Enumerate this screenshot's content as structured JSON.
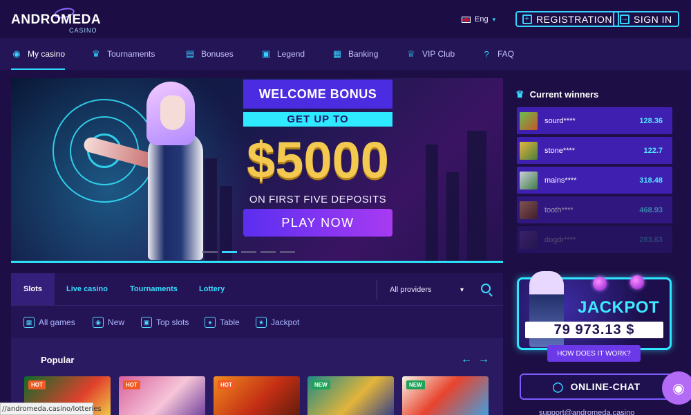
{
  "header": {
    "logo_main": "ANDROMEDA",
    "logo_sub": "CASINO",
    "language": "Eng",
    "registration": "REGISTRATION",
    "signin": "SIGN IN"
  },
  "nav": {
    "items": [
      {
        "label": "My casino",
        "icon": "astronaut-icon"
      },
      {
        "label": "Tournaments",
        "icon": "trophy-icon"
      },
      {
        "label": "Bonuses",
        "icon": "gift-icon"
      },
      {
        "label": "Legend",
        "icon": "book-icon"
      },
      {
        "label": "Banking",
        "icon": "wallet-icon"
      },
      {
        "label": "VIP Club",
        "icon": "crown-icon"
      },
      {
        "label": "FAQ",
        "icon": "faq-icon"
      }
    ]
  },
  "banner": {
    "title": "WELCOME BONUS",
    "subtitle": "GET UP TO",
    "amount": "$5000",
    "deposits": "ON FIRST FIVE DEPOSITS",
    "cta": "PLAY NOW",
    "active_slide": 2,
    "slide_count": 5
  },
  "winners": {
    "title": "Current winners",
    "rows": [
      {
        "name": "sourd****",
        "amount": "128.36"
      },
      {
        "name": "stone****",
        "amount": "122.7"
      },
      {
        "name": "mains****",
        "amount": "318.48"
      },
      {
        "name": "tooth****",
        "amount": "468.93"
      },
      {
        "name": "dogdr****",
        "amount": "283.63"
      }
    ]
  },
  "jackpot": {
    "title": "JACKPOT",
    "value": "79 973.13 $",
    "how": "HOW DOES IT WORK?"
  },
  "chat": {
    "label": "ONLINE-CHAT",
    "support": "support@andromeda.casino"
  },
  "games": {
    "tabs": [
      "Slots",
      "Live casino",
      "Tournaments",
      "Lottery"
    ],
    "provider": "All providers",
    "categories": [
      "All games",
      "New",
      "Top slots",
      "Table",
      "Jackpot"
    ],
    "popular_title": "Popular",
    "tiles": [
      {
        "badge": "HOT"
      },
      {
        "badge": "HOT"
      },
      {
        "badge": "HOT"
      },
      {
        "badge": "NEW"
      },
      {
        "badge": "NEW"
      }
    ]
  },
  "statusbar": {
    "url": "//andromeda.casino/lotteries"
  },
  "colors": {
    "accent": "#35d4ff",
    "primary": "#4b2ce0",
    "gold": "#f4c950",
    "background": "#1d0f45"
  }
}
